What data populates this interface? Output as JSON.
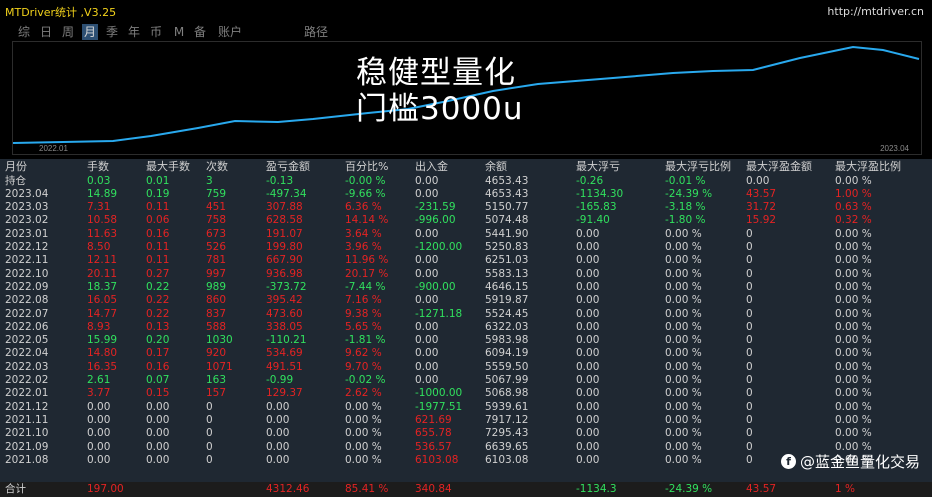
{
  "window": {
    "title": "MTDriver统计 ,V3.25",
    "url": "http://mtdriver.cn"
  },
  "tabs": [
    {
      "label": "综"
    },
    {
      "label": "日"
    },
    {
      "label": "周"
    },
    {
      "label": "月",
      "active": true
    },
    {
      "label": "季"
    },
    {
      "label": "年"
    },
    {
      "label": "币"
    },
    {
      "label": "M"
    },
    {
      "label": "备"
    },
    {
      "label": "账户"
    },
    {
      "label": "路径"
    }
  ],
  "overlay": {
    "line1": "稳健型量化",
    "line2": "门槛3000u"
  },
  "chart_data": {
    "type": "line",
    "x_start_label": "2022.01",
    "x_end_label": "2023.04",
    "line_color": "#29a9ee"
  },
  "colors": {
    "pos": "#31e05e",
    "neg": "#e32323",
    "neutral": "#d0d0d0",
    "title": "#f2d21b"
  },
  "table": {
    "headers": [
      "月份",
      "手数",
      "最大手数",
      "次数",
      "盈亏金额",
      "百分比%",
      "出入金",
      "余额",
      "最大浮亏",
      "最大浮亏比例",
      "最大浮盈金额",
      "最大浮盈比例"
    ],
    "rows": [
      {
        "c": [
          "持仓",
          "0.03",
          "0.01",
          "3",
          "-0.13",
          "-0.00 %",
          "0.00",
          "4653.43",
          "-0.26",
          "-0.01 %",
          "0.00",
          "0.00 %"
        ],
        "t": "pos"
      },
      {
        "c": [
          "2023.04",
          "14.89",
          "0.19",
          "759",
          "-497.34",
          "-9.66 %",
          "0.00",
          "4653.43",
          "-1134.30",
          "-24.39 %",
          "43.57",
          "1.00 %"
        ],
        "t": "pos",
        "split": 10
      },
      {
        "c": [
          "2023.03",
          "7.31",
          "0.11",
          "451",
          "307.88",
          "6.36 %",
          "-231.59",
          "5150.77",
          "-165.83",
          "-3.18 %",
          "31.72",
          "0.63 %"
        ],
        "t": "neg"
      },
      {
        "c": [
          "2023.02",
          "10.58",
          "0.06",
          "758",
          "628.58",
          "14.14 %",
          "-996.00",
          "5074.48",
          "-91.40",
          "-1.80 %",
          "15.92",
          "0.32 %"
        ],
        "t": "neg"
      },
      {
        "c": [
          "2023.01",
          "11.63",
          "0.16",
          "673",
          "191.07",
          "3.64 %",
          "0.00",
          "5441.90",
          "0.00",
          "0.00 %",
          "0",
          "0.00 %"
        ],
        "t": "neg"
      },
      {
        "c": [
          "2022.12",
          "8.50",
          "0.11",
          "526",
          "199.80",
          "3.96 %",
          "-1200.00",
          "5250.83",
          "0.00",
          "0.00 %",
          "0",
          "0.00 %"
        ],
        "t": "neg"
      },
      {
        "c": [
          "2022.11",
          "12.11",
          "0.11",
          "781",
          "667.90",
          "11.96 %",
          "0.00",
          "6251.03",
          "0.00",
          "0.00 %",
          "0",
          "0.00 %"
        ],
        "t": "neg"
      },
      {
        "c": [
          "2022.10",
          "20.11",
          "0.27",
          "997",
          "936.98",
          "20.17 %",
          "0.00",
          "5583.13",
          "0.00",
          "0.00 %",
          "0",
          "0.00 %"
        ],
        "t": "neg"
      },
      {
        "c": [
          "2022.09",
          "18.37",
          "0.22",
          "989",
          "-373.72",
          "-7.44 %",
          "-900.00",
          "4646.15",
          "0.00",
          "0.00 %",
          "0",
          "0.00 %"
        ],
        "t": "pos"
      },
      {
        "c": [
          "2022.08",
          "16.05",
          "0.22",
          "860",
          "395.42",
          "7.16 %",
          "0.00",
          "5919.87",
          "0.00",
          "0.00 %",
          "0",
          "0.00 %"
        ],
        "t": "neg"
      },
      {
        "c": [
          "2022.07",
          "14.77",
          "0.22",
          "837",
          "473.60",
          "9.38 %",
          "-1271.18",
          "5524.45",
          "0.00",
          "0.00 %",
          "0",
          "0.00 %"
        ],
        "t": "neg"
      },
      {
        "c": [
          "2022.06",
          "8.93",
          "0.13",
          "588",
          "338.05",
          "5.65 %",
          "0.00",
          "6322.03",
          "0.00",
          "0.00 %",
          "0",
          "0.00 %"
        ],
        "t": "neg"
      },
      {
        "c": [
          "2022.05",
          "15.99",
          "0.20",
          "1030",
          "-110.21",
          "-1.81 %",
          "0.00",
          "5983.98",
          "0.00",
          "0.00 %",
          "0",
          "0.00 %"
        ],
        "t": "pos"
      },
      {
        "c": [
          "2022.04",
          "14.80",
          "0.17",
          "920",
          "534.69",
          "9.62 %",
          "0.00",
          "6094.19",
          "0.00",
          "0.00 %",
          "0",
          "0.00 %"
        ],
        "t": "neg"
      },
      {
        "c": [
          "2022.03",
          "16.35",
          "0.16",
          "1071",
          "491.51",
          "9.70 %",
          "0.00",
          "5559.50",
          "0.00",
          "0.00 %",
          "0",
          "0.00 %"
        ],
        "t": "neg"
      },
      {
        "c": [
          "2022.02",
          "2.61",
          "0.07",
          "163",
          "-0.99",
          "-0.02 %",
          "0.00",
          "5067.99",
          "0.00",
          "0.00 %",
          "0",
          "0.00 %"
        ],
        "t": "pos"
      },
      {
        "c": [
          "2022.01",
          "3.77",
          "0.15",
          "157",
          "129.37",
          "2.62 %",
          "-1000.00",
          "5068.98",
          "0.00",
          "0.00 %",
          "0",
          "0.00 %"
        ],
        "t": "neg"
      },
      {
        "c": [
          "2021.12",
          "0.00",
          "0.00",
          "0",
          "0.00",
          "0.00 %",
          "-1977.51",
          "5939.61",
          "0.00",
          "0.00 %",
          "0",
          "0.00 %"
        ],
        "t": "neutral"
      },
      {
        "c": [
          "2021.11",
          "0.00",
          "0.00",
          "0",
          "0.00",
          "0.00 %",
          "621.69",
          "7917.12",
          "0.00",
          "0.00 %",
          "0",
          "0.00 %"
        ],
        "t": "neutral"
      },
      {
        "c": [
          "2021.10",
          "0.00",
          "0.00",
          "0",
          "0.00",
          "0.00 %",
          "655.78",
          "7295.43",
          "0.00",
          "0.00 %",
          "0",
          "0.00 %"
        ],
        "t": "neutral"
      },
      {
        "c": [
          "2021.09",
          "0.00",
          "0.00",
          "0",
          "0.00",
          "0.00 %",
          "536.57",
          "6639.65",
          "0.00",
          "0.00 %",
          "0",
          "0.00 %"
        ],
        "t": "neutral"
      },
      {
        "c": [
          "2021.08",
          "0.00",
          "0.00",
          "0",
          "0.00",
          "0.00 %",
          "6103.08",
          "6103.08",
          "0.00",
          "0.00 %",
          "0",
          "0.00 %"
        ],
        "t": "neutral"
      }
    ],
    "total": {
      "c": [
        "合计",
        "197.00",
        "",
        "",
        "4312.46",
        "85.41 %",
        "340.84",
        "",
        "-1134.3",
        "-24.39 %",
        "43.57",
        "1 %"
      ]
    }
  },
  "watermark": {
    "logo": "f",
    "text": "@蓝金鱼量化交易"
  }
}
